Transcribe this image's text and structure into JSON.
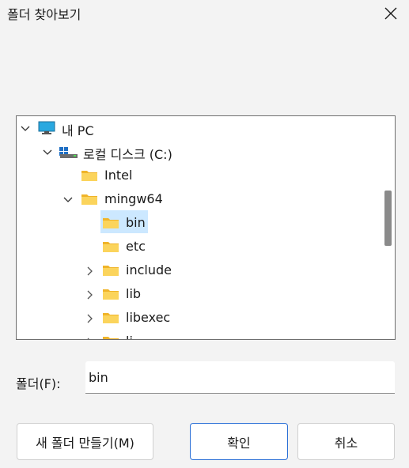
{
  "window": {
    "title": "폴더 찾아보기"
  },
  "tree": {
    "items": [
      {
        "label": "내 PC",
        "icon": "computer-icon",
        "expanded": true
      },
      {
        "label": "로컬 디스크 (C:)",
        "icon": "drive-icon",
        "expanded": true
      },
      {
        "label": "Intel",
        "icon": "folder-icon"
      },
      {
        "label": "mingw64",
        "icon": "folder-icon",
        "expanded": true
      },
      {
        "label": "bin",
        "icon": "folder-icon",
        "selected": true
      },
      {
        "label": "etc",
        "icon": "folder-icon"
      },
      {
        "label": "include",
        "icon": "folder-icon",
        "collapsed": true
      },
      {
        "label": "lib",
        "icon": "folder-icon",
        "collapsed": true
      },
      {
        "label": "libexec",
        "icon": "folder-icon",
        "collapsed": true
      },
      {
        "label": "li",
        "icon": "folder-icon",
        "collapsed": true
      }
    ]
  },
  "folder_field": {
    "label": "폴더(F):",
    "value": "bin"
  },
  "buttons": {
    "new_folder": "새 폴더 만들기(M)",
    "ok": "확인",
    "cancel": "취소"
  },
  "colors": {
    "selection": "#cce8ff",
    "folder": "#f8c93d",
    "accent": "#2a6fd6"
  }
}
